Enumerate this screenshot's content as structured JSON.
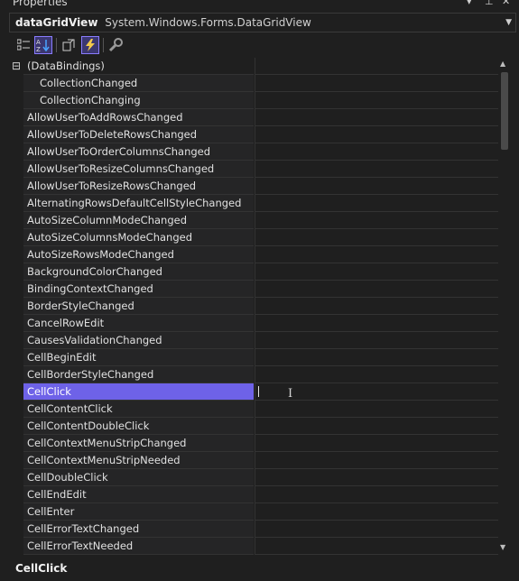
{
  "window": {
    "title": "Properties",
    "pin_icon": "pin-icon",
    "close_icon": "close-icon"
  },
  "object_selector": {
    "name": "dataGridView",
    "type": "System.Windows.Forms.DataGridView"
  },
  "toolbar": {
    "buttons": [
      {
        "name": "categorized-icon",
        "active": false
      },
      {
        "name": "alphabetical-icon",
        "active": true
      },
      {
        "name": "properties-icon",
        "active": false
      },
      {
        "name": "events-icon",
        "active": true
      },
      {
        "name": "property-pages-icon",
        "active": false
      }
    ]
  },
  "grid": {
    "rows": [
      {
        "label": "(DataBindings)",
        "kind": "category",
        "expander": "⊟"
      },
      {
        "label": "CollectionChanged",
        "kind": "child"
      },
      {
        "label": "CollectionChanging",
        "kind": "child"
      },
      {
        "label": "AllowUserToAddRowsChanged"
      },
      {
        "label": "AllowUserToDeleteRowsChanged"
      },
      {
        "label": "AllowUserToOrderColumnsChanged"
      },
      {
        "label": "AllowUserToResizeColumnsChanged"
      },
      {
        "label": "AllowUserToResizeRowsChanged"
      },
      {
        "label": "AlternatingRowsDefaultCellStyleChanged"
      },
      {
        "label": "AutoSizeColumnModeChanged"
      },
      {
        "label": "AutoSizeColumnsModeChanged"
      },
      {
        "label": "AutoSizeRowsModeChanged"
      },
      {
        "label": "BackgroundColorChanged"
      },
      {
        "label": "BindingContextChanged"
      },
      {
        "label": "BorderStyleChanged"
      },
      {
        "label": "CancelRowEdit"
      },
      {
        "label": "CausesValidationChanged"
      },
      {
        "label": "CellBeginEdit"
      },
      {
        "label": "CellBorderStyleChanged"
      },
      {
        "label": "CellClick",
        "selected": true
      },
      {
        "label": "CellContentClick"
      },
      {
        "label": "CellContentDoubleClick"
      },
      {
        "label": "CellContextMenuStripChanged"
      },
      {
        "label": "CellContextMenuStripNeeded"
      },
      {
        "label": "CellDoubleClick"
      },
      {
        "label": "CellEndEdit"
      },
      {
        "label": "CellEnter"
      },
      {
        "label": "CellErrorTextChanged"
      },
      {
        "label": "CellErrorTextNeeded"
      }
    ]
  },
  "description": {
    "title": "CellClick"
  },
  "colors": {
    "selection": "#6e62e8",
    "background": "#1f1f1f",
    "accent_border": "#8a7cff"
  }
}
